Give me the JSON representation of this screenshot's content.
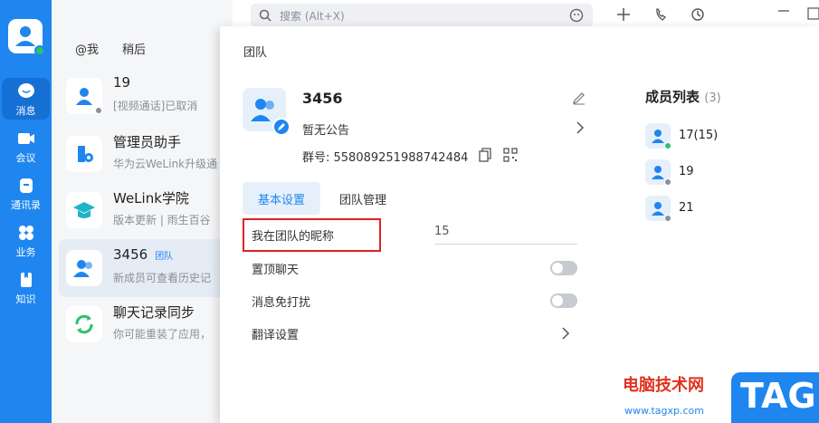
{
  "nav": {
    "items": [
      {
        "label": "消息",
        "icon": "chat-icon",
        "active": true
      },
      {
        "label": "会议",
        "icon": "video-icon"
      },
      {
        "label": "通讯录",
        "icon": "contacts-icon"
      },
      {
        "label": "业务",
        "icon": "apps-icon"
      },
      {
        "label": "知识",
        "icon": "book-icon"
      }
    ]
  },
  "list": {
    "tabs": [
      "@我",
      "稍后"
    ],
    "rows": [
      {
        "name": "19",
        "sub": "[视频通话]已取消",
        "icon": "user-icon",
        "status": "offline"
      },
      {
        "name": "管理员助手",
        "sub": "华为云WeLink升级通",
        "icon": "admin-icon"
      },
      {
        "name": "WeLink学院",
        "sub": "版本更新 | 雨生百谷",
        "icon": "graduation-cap-icon"
      },
      {
        "name": "3456",
        "tag": "团队",
        "sub": "新成员可查看历史记",
        "icon": "group-icon",
        "active": true
      },
      {
        "name": "聊天记录同步",
        "sub": "你可能重装了应用，",
        "icon": "sync-icon"
      }
    ]
  },
  "topbar": {
    "search_placeholder": "搜索 (Alt+X)"
  },
  "panel": {
    "title": "团队",
    "group_name": "3456",
    "notice": "暂无公告",
    "group_id": "群号: 5580892519887424​84",
    "tabs": [
      "基本设置",
      "团队管理"
    ],
    "settings": {
      "nickname_label": "我在团队的昵称",
      "nickname_value": "15",
      "pin_label": "置顶聊天",
      "mute_label": "消息免打扰",
      "translate_label": "翻译设置"
    },
    "members": {
      "title": "成员列表",
      "count": "(3)",
      "items": [
        {
          "name": "17(15)",
          "status": "online"
        },
        {
          "name": "19",
          "status": "offline"
        },
        {
          "name": "21",
          "status": "offline"
        }
      ]
    }
  },
  "watermark": {
    "cn": "电脑技术网",
    "url": "www.tagxp.com",
    "logo": "TAG"
  },
  "colors": {
    "accent": "#1f86f0",
    "online": "#2bc26b",
    "offline": "#8a8f98",
    "highlight": "#e02020"
  }
}
